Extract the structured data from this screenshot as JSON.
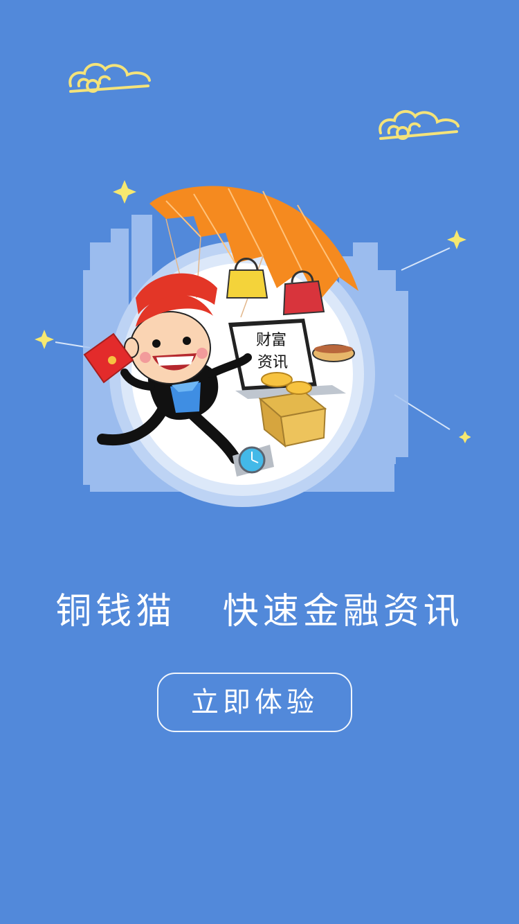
{
  "hero": {
    "laptop_line1": "财富",
    "laptop_line2": "资讯"
  },
  "tagline": {
    "brand": "铜钱猫",
    "slogan": "快速金融资讯"
  },
  "cta": {
    "label": "立即体验"
  },
  "colors": {
    "background": "#5289DA",
    "cloud": "#F4E37A",
    "parachute": "#F58A1F",
    "cta_border": "#FFFFFF"
  }
}
